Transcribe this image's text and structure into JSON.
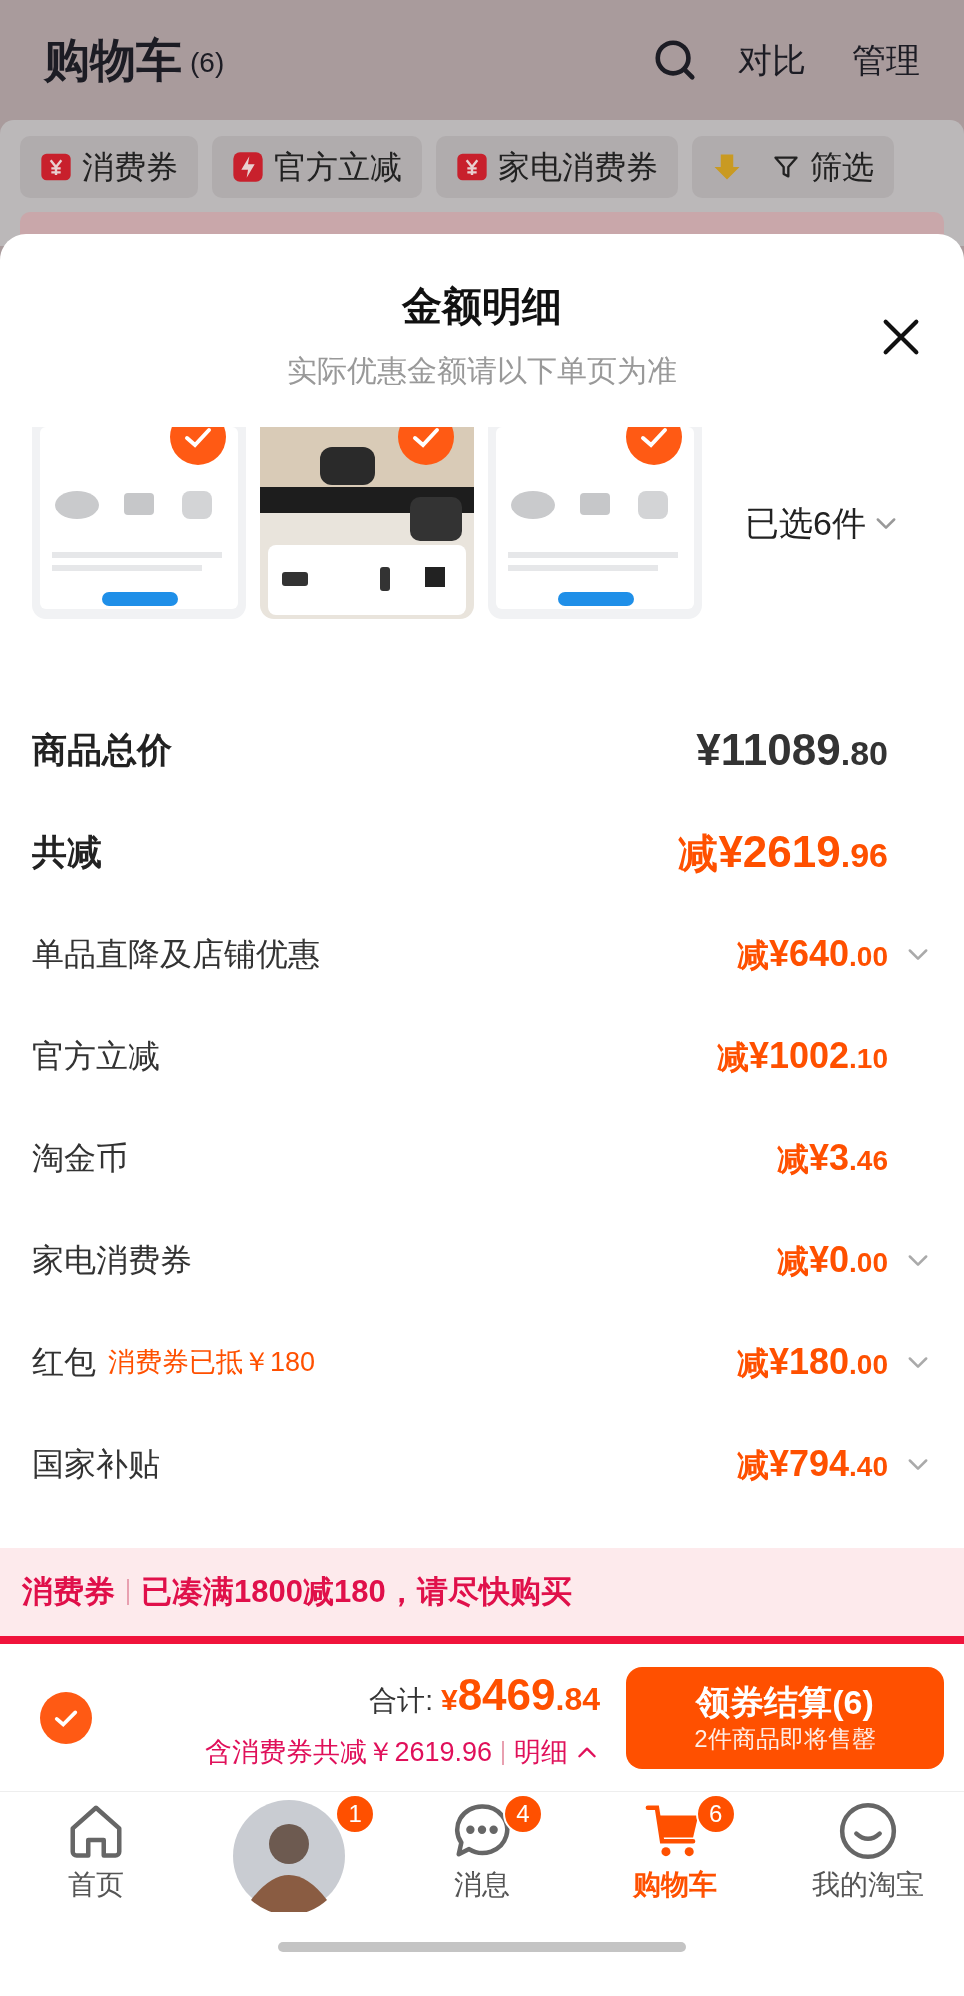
{
  "header": {
    "title": "购物车",
    "count": "(6)",
    "actions": [
      "对比",
      "管理"
    ]
  },
  "filters": [
    {
      "label": "消费券",
      "kind": "coupon"
    },
    {
      "label": "官方立减",
      "kind": "flash"
    },
    {
      "label": "家电消费券",
      "kind": "coupon"
    },
    {
      "label": "筛选",
      "kind": "filter"
    }
  ],
  "sheet": {
    "title": "金额明细",
    "subtitle": "实际优惠金额请以下单页为准",
    "products": [
      {
        "kind": "picture",
        "selected": true
      },
      {
        "kind": "picture",
        "selected": true
      },
      {
        "kind": "picture",
        "selected": true
      }
    ],
    "selected_count": "已选6件",
    "rows": [
      {
        "kind": "total",
        "label": "商品总价",
        "prefix": "",
        "amount": "¥11089",
        "decimals": ".80",
        "expandable": false
      },
      {
        "kind": "total",
        "label": "共减",
        "prefix": "减",
        "amount": "¥2619",
        "decimals": ".96",
        "expandable": false
      },
      {
        "kind": "item",
        "label": "单品直降及店铺优惠",
        "prefix": "减",
        "amount": "¥640",
        "decimals": ".00",
        "expandable": true
      },
      {
        "kind": "item",
        "label": "官方立减",
        "prefix": "减",
        "amount": "¥1002",
        "decimals": ".10",
        "expandable": false
      },
      {
        "kind": "item",
        "label": "淘金币",
        "prefix": "减",
        "amount": "¥3",
        "decimals": ".46",
        "expandable": false
      },
      {
        "kind": "item",
        "label": "家电消费券",
        "prefix": "减",
        "amount": "¥0",
        "decimals": ".00",
        "expandable": true
      },
      {
        "kind": "item",
        "label": "红包",
        "note": "消费券已抵￥180",
        "prefix": "减",
        "amount": "¥180",
        "decimals": ".00",
        "expandable": true
      },
      {
        "kind": "item",
        "label": "国家补贴",
        "prefix": "减",
        "amount": "¥794",
        "decimals": ".40",
        "expandable": true
      }
    ]
  },
  "coupon_banner": {
    "tag": "消费券",
    "message": "已凑满1800减180，请尽快购买"
  },
  "checkout": {
    "select_all": true,
    "total_label": "合计:",
    "total": "¥8469",
    "total_decimals": ".84",
    "saving": "含消费券共减￥2619.96",
    "detail_link": "明细",
    "button_title": "领券结算(6)",
    "button_subtitle": "2件商品即将售罄"
  },
  "tabbar": [
    {
      "kind": "home",
      "label": "首页",
      "selected": false
    },
    {
      "kind": "avatar",
      "badge": "1",
      "selected": false
    },
    {
      "kind": "message",
      "label": "消息",
      "badge": "4",
      "selected": false
    },
    {
      "kind": "cart",
      "label": "购物车",
      "badge": "6",
      "selected": true
    },
    {
      "kind": "profile",
      "label": "我的淘宝",
      "selected": false
    }
  ]
}
